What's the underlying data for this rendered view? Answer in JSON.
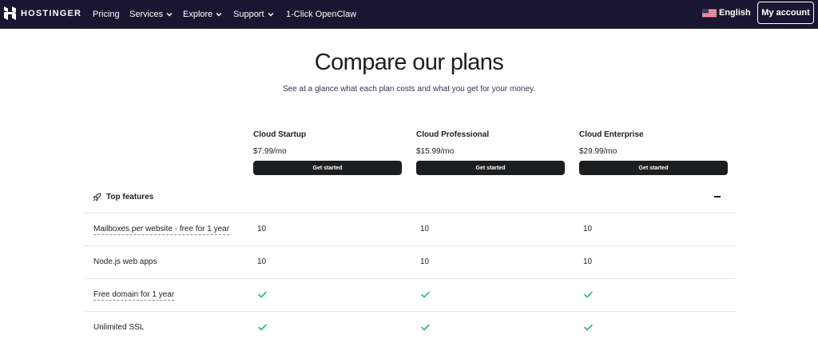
{
  "header": {
    "logo_text": "HOSTINGER",
    "nav": [
      {
        "label": "Pricing",
        "has_chevron": false
      },
      {
        "label": "Services",
        "has_chevron": true
      },
      {
        "label": "Explore",
        "has_chevron": true
      },
      {
        "label": "Support",
        "has_chevron": true
      },
      {
        "label": "1-Click OpenClaw",
        "has_chevron": false
      }
    ],
    "language": "English",
    "account_label": "My account",
    "colors": {
      "background": "#1a1530",
      "text": "#ffffff"
    }
  },
  "hero": {
    "title": "Compare our plans",
    "subtitle": "See at a glance what each plan costs and what you get for your money."
  },
  "plans": [
    {
      "name": "Cloud Startup",
      "price": "$7.99/mo",
      "cta": "Get started"
    },
    {
      "name": "Cloud Professional",
      "price": "$15.99/mo",
      "cta": "Get started"
    },
    {
      "name": "Cloud Enterprise",
      "price": "$29.99/mo",
      "cta": "Get started"
    }
  ],
  "section": {
    "title": "Top features",
    "icon": "rocket-icon",
    "toggle_icon": "minus-icon"
  },
  "features": [
    {
      "label": "Mailboxes per website - free for 1 year",
      "tooltip_underline": true,
      "values": [
        "10",
        "10",
        "10"
      ]
    },
    {
      "label": "Node.js web apps",
      "tooltip_underline": false,
      "values": [
        "10",
        "10",
        "10"
      ]
    },
    {
      "label": "Free domain for 1 year",
      "tooltip_underline": true,
      "values": [
        "check",
        "check",
        "check"
      ]
    },
    {
      "label": "Unlimited SSL",
      "tooltip_underline": false,
      "values": [
        "check",
        "check",
        "check"
      ]
    }
  ],
  "colors": {
    "check": "#00b090",
    "button": "#1d1e20",
    "divider": "#e6e6ec"
  }
}
